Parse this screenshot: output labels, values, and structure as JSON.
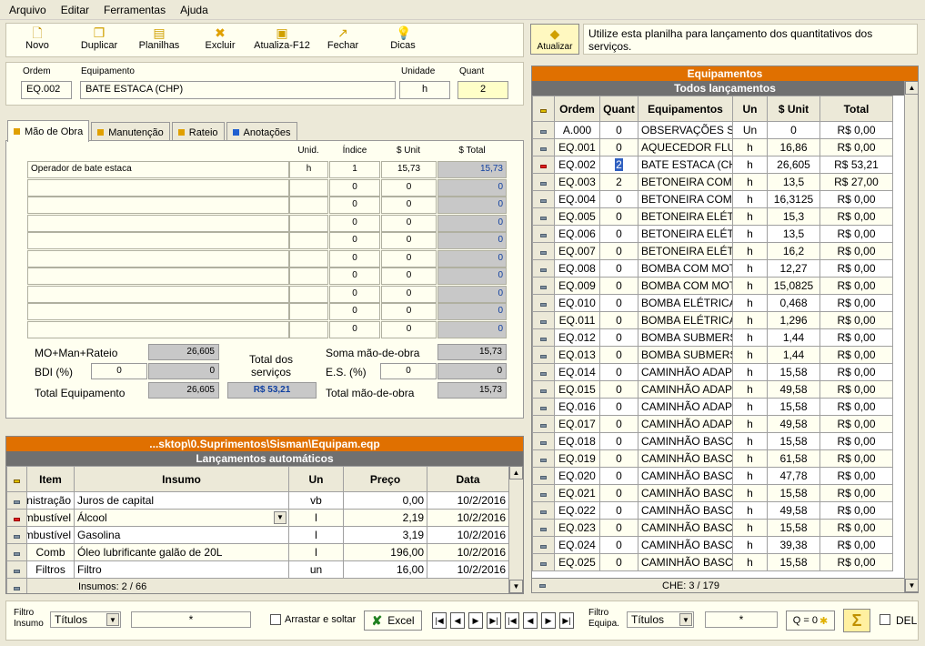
{
  "menu": [
    "Arquivo",
    "Editar",
    "Ferramentas",
    "Ajuda"
  ],
  "toolbar": [
    "Novo",
    "Duplicar",
    "Planilhas",
    "Excluir",
    "Atualiza-F12",
    "Fechar",
    "Dicas"
  ],
  "atualizar": "Atualizar",
  "hint": "Utilize esta planilha para lançamento dos quantitativos dos serviços.",
  "header": {
    "ordem_label": "Ordem",
    "ordem": "EQ.002",
    "equip_label": "Equipamento",
    "equip": "BATE ESTACA (CHP)",
    "unid_label": "Unidade",
    "unid": "h",
    "quant_label": "Quant",
    "quant": "2"
  },
  "tabs": [
    "Mão de Obra",
    "Manutenção",
    "Rateio",
    "Anotações"
  ],
  "mo_headers": [
    "Unid.",
    "Índice",
    "$ Unit",
    "$ Total"
  ],
  "mo_rows": [
    [
      "Operador de bate estaca",
      "h",
      "1",
      "15,73",
      "15,73"
    ],
    [
      "",
      "",
      "0",
      "0",
      "0"
    ],
    [
      "",
      "",
      "0",
      "0",
      "0"
    ],
    [
      "",
      "",
      "0",
      "0",
      "0"
    ],
    [
      "",
      "",
      "0",
      "0",
      "0"
    ],
    [
      "",
      "",
      "0",
      "0",
      "0"
    ],
    [
      "",
      "",
      "0",
      "0",
      "0"
    ],
    [
      "",
      "",
      "0",
      "0",
      "0"
    ],
    [
      "",
      "",
      "0",
      "0",
      "0"
    ],
    [
      "",
      "",
      "0",
      "0",
      "0"
    ]
  ],
  "summary": {
    "mo_label": "MO+Man+Rateio",
    "mo": "26,605",
    "bdi_label": "BDI (%)",
    "bdi_in": "0",
    "bdi": "0",
    "te_label": "Total Equipamento",
    "te": "26,605",
    "ts_label": "Total dos serviços",
    "ts": "R$ 53,21",
    "smo_label": "Soma mão-de-obra",
    "smo": "15,73",
    "es_label": "E.S. (%)",
    "es_in": "0",
    "es": "0",
    "tmo_label": "Total mão-de-obra",
    "tmo": "15,73"
  },
  "lower": {
    "path": "...sktop\\0.Suprimentos\\Sisman\\Equipam.eqp",
    "title": "Lançamentos automáticos",
    "headers": [
      "Item",
      "Insumo",
      "Un",
      "Preço",
      "Data"
    ],
    "rows": [
      [
        "Ministração",
        "Juros de capital",
        "vb",
        "0,00",
        "10/2/2016"
      ],
      [
        "Combustível",
        "Álcool",
        "l",
        "2,19",
        "10/2/2016"
      ],
      [
        "Combustível",
        "Gasolina",
        "l",
        "3,19",
        "10/2/2016"
      ],
      [
        "Comb",
        "Óleo lubrificante galão de 20L",
        "l",
        "196,00",
        "10/2/2016"
      ],
      [
        "Filtros",
        "Filtro",
        "un",
        "16,00",
        "10/2/2016"
      ]
    ],
    "footer": "Insumos: 2 / 66"
  },
  "right": {
    "title": "Equipamentos",
    "subtitle": "Todos lançamentos",
    "headers": [
      "Ordem",
      "Quant",
      "Equipamentos",
      "Un",
      "$ Unit",
      "Total"
    ],
    "rows": [
      [
        "A.000",
        "0",
        "OBSERVAÇÕES SOBRE",
        "Un",
        "0",
        "R$ 0,00"
      ],
      [
        "EQ.001",
        "0",
        "AQUECEDOR FLUIDO",
        "h",
        "16,86",
        "R$ 0,00"
      ],
      [
        "EQ.002",
        "2",
        "BATE ESTACA (CHP)",
        "h",
        "26,605",
        "R$ 53,21"
      ],
      [
        "EQ.003",
        "2",
        "BETONEIRA COM MOTOR",
        "h",
        "13,5",
        "R$ 27,00"
      ],
      [
        "EQ.004",
        "0",
        "BETONEIRA COM MOTOR",
        "h",
        "16,3125",
        "R$ 0,00"
      ],
      [
        "EQ.005",
        "0",
        "BETONEIRA ELÉTRICA",
        "h",
        "15,3",
        "R$ 0,00"
      ],
      [
        "EQ.006",
        "0",
        "BETONEIRA ELÉTRICA",
        "h",
        "13,5",
        "R$ 0,00"
      ],
      [
        "EQ.007",
        "0",
        "BETONEIRA ELÉTRICA",
        "h",
        "16,2",
        "R$ 0,00"
      ],
      [
        "EQ.008",
        "0",
        "BOMBA COM MOTOR",
        "h",
        "12,27",
        "R$ 0,00"
      ],
      [
        "EQ.009",
        "0",
        "BOMBA COM MOTOR",
        "h",
        "15,0825",
        "R$ 0,00"
      ],
      [
        "EQ.010",
        "0",
        "BOMBA ELÉTRICA P",
        "h",
        "0,468",
        "R$ 0,00"
      ],
      [
        "EQ.011",
        "0",
        "BOMBA ELÉTRICA P",
        "h",
        "1,296",
        "R$ 0,00"
      ],
      [
        "EQ.012",
        "0",
        "BOMBA SUBMERSÍVEL",
        "h",
        "1,44",
        "R$ 0,00"
      ],
      [
        "EQ.013",
        "0",
        "BOMBA SUBMERSÍVEL",
        "h",
        "1,44",
        "R$ 0,00"
      ],
      [
        "EQ.014",
        "0",
        "CAMINHÃO ADAPTADO",
        "h",
        "15,58",
        "R$ 0,00"
      ],
      [
        "EQ.015",
        "0",
        "CAMINHÃO ADAPTADO",
        "h",
        "49,58",
        "R$ 0,00"
      ],
      [
        "EQ.016",
        "0",
        "CAMINHÃO ADAPTADO",
        "h",
        "15,58",
        "R$ 0,00"
      ],
      [
        "EQ.017",
        "0",
        "CAMINHÃO ADAPTADO",
        "h",
        "49,58",
        "R$ 0,00"
      ],
      [
        "EQ.018",
        "0",
        "CAMINHÃO BASCULANTE",
        "h",
        "15,58",
        "R$ 0,00"
      ],
      [
        "EQ.019",
        "0",
        "CAMINHÃO BASCULANTE",
        "h",
        "61,58",
        "R$ 0,00"
      ],
      [
        "EQ.020",
        "0",
        "CAMINHÃO BASCULANTE",
        "h",
        "47,78",
        "R$ 0,00"
      ],
      [
        "EQ.021",
        "0",
        "CAMINHÃO BASCULANTE",
        "h",
        "15,58",
        "R$ 0,00"
      ],
      [
        "EQ.022",
        "0",
        "CAMINHÃO BASCULANTE",
        "h",
        "49,58",
        "R$ 0,00"
      ],
      [
        "EQ.023",
        "0",
        "CAMINHÃO BASCULANTE",
        "h",
        "15,58",
        "R$ 0,00"
      ],
      [
        "EQ.024",
        "0",
        "CAMINHÃO BASCULANTE",
        "h",
        "39,38",
        "R$ 0,00"
      ],
      [
        "EQ.025",
        "0",
        "CAMINHÃO BASCULANTE",
        "h",
        "15,58",
        "R$ 0,00"
      ]
    ],
    "footer": "CHE: 3 / 179"
  },
  "bottom": {
    "filtro_insumo": "Filtro Insumo",
    "titulos": "Títulos",
    "search": "*",
    "arrastar": "Arrastar e soltar",
    "excel": "Excel",
    "filtro_equipa": "Filtro Equipa.",
    "titulos2": "Títulos",
    "search2": "*",
    "q": "Q = 0",
    "del": "DEL"
  }
}
